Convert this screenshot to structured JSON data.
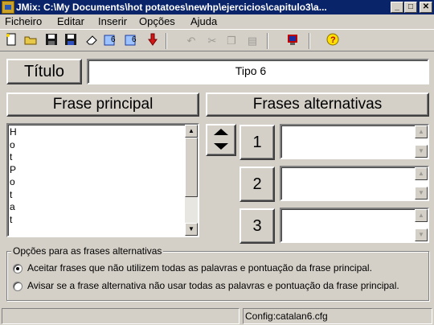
{
  "window": {
    "title": "JMix: C:\\My Documents\\hot potatoes\\newhp\\ejercicios\\capitulo3\\a...",
    "buttons": {
      "minimize": "_",
      "maximize": "□",
      "close": "✕"
    }
  },
  "menu": [
    "Ficheiro",
    "Editar",
    "Inserir",
    "Opções",
    "Ajuda"
  ],
  "toolbar_icons": [
    "new-icon",
    "open-icon",
    "save-icon",
    "save-as-icon",
    "eraser-icon",
    "web-page-6-icon",
    "web-page-6-alt-icon",
    "export-arrow-icon",
    "undo-icon",
    "cut-icon",
    "copy-icon",
    "paste-icon",
    "config-icon",
    "help-icon"
  ],
  "title_section": {
    "label": "Título",
    "value": "Tipo 6"
  },
  "main_phrase": {
    "label": "Frase principal",
    "lines": [
      "H",
      "o",
      "t",
      "P",
      "o",
      "t",
      "a",
      "t"
    ]
  },
  "alternatives": {
    "label": "Frases alternativas",
    "items": [
      {
        "number": "1",
        "value": ""
      },
      {
        "number": "2",
        "value": ""
      },
      {
        "number": "3",
        "value": ""
      }
    ]
  },
  "options": {
    "legend": "Opções para as frases alternativas",
    "choices": [
      {
        "label": "Aceitar frases que não utilizem todas as palavras e pontuação da frase principal.",
        "selected": true
      },
      {
        "label": "Avisar se a frase alternativa não usar todas as palavras e pontuação da frase principal.",
        "selected": false
      }
    ]
  },
  "status": {
    "left": "",
    "config": "Config:catalan6.cfg"
  }
}
